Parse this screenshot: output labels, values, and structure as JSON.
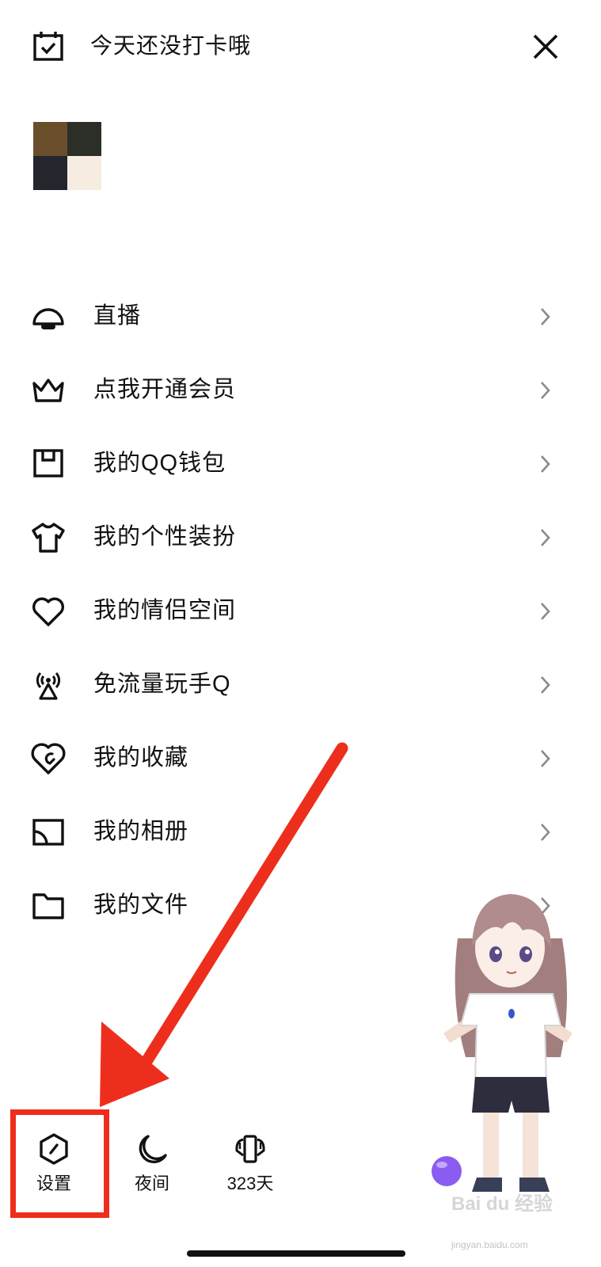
{
  "header": {
    "checkin_text": "今天还没打卡哦",
    "checkin_icon": "calendar-check-icon",
    "close_icon": "close-icon"
  },
  "menu": {
    "items": [
      {
        "label": "直播",
        "icon": "live-icon"
      },
      {
        "label": "点我开通会员",
        "icon": "crown-icon"
      },
      {
        "label": "我的QQ钱包",
        "icon": "wallet-icon"
      },
      {
        "label": "我的个性装扮",
        "icon": "tshirt-icon"
      },
      {
        "label": "我的情侣空间",
        "icon": "heart-icon"
      },
      {
        "label": "免流量玩手Q",
        "icon": "antenna-icon"
      },
      {
        "label": "我的收藏",
        "icon": "favorite-icon"
      },
      {
        "label": "我的相册",
        "icon": "album-icon"
      },
      {
        "label": "我的文件",
        "icon": "folder-icon"
      }
    ]
  },
  "bottom_bar": {
    "settings_label": "设置",
    "night_label": "夜间",
    "days_label": "323天"
  },
  "watermark": {
    "main": "Bai du 经验",
    "sub": "jingyan.baidu.com"
  },
  "colors": {
    "annotation_red": "#ee2e1c",
    "text": "#111111",
    "background": "#ffffff"
  }
}
